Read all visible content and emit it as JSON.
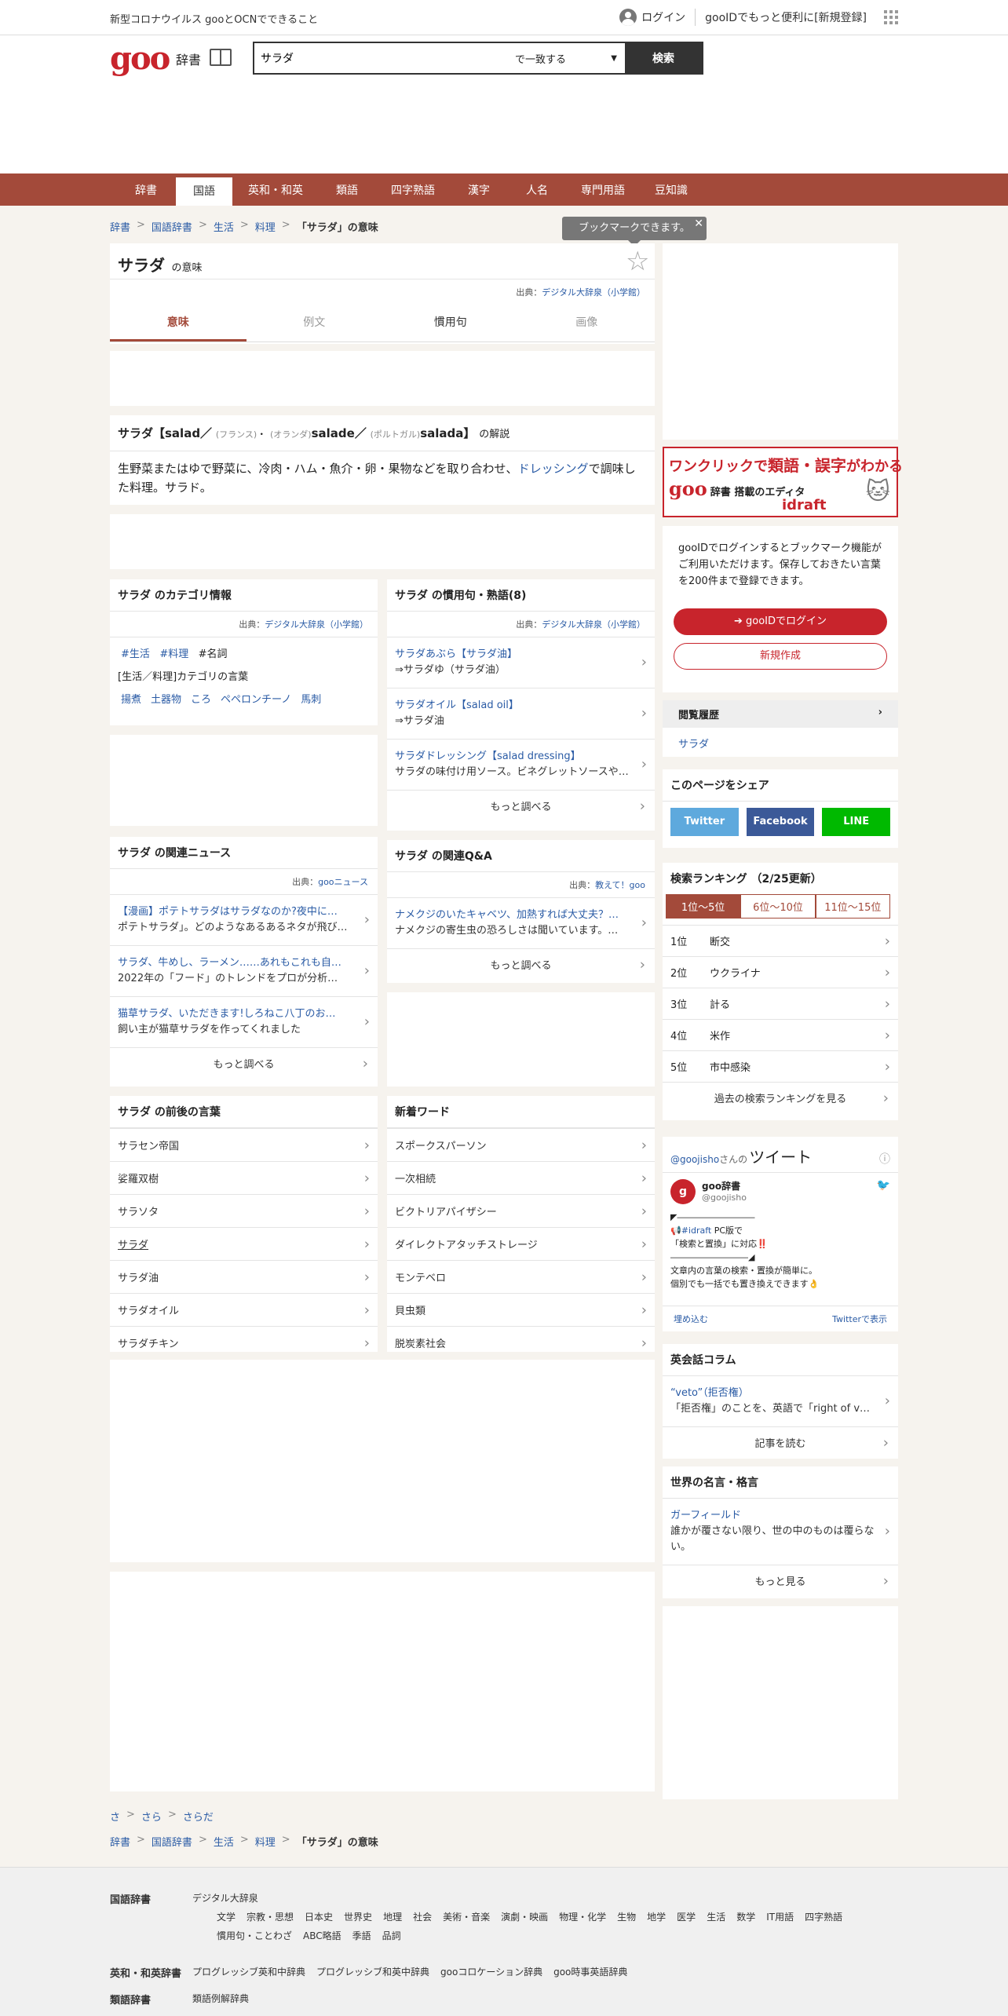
{
  "topbar": {
    "notice": "新型コロナウイルス gooとOCNでできること",
    "login": "ログイン",
    "register": "gooIDでもっと便利に[新規登録]"
  },
  "header": {
    "logo": "goo",
    "logo_sub": "辞書",
    "search_value": "サラダ",
    "search_mode": "で一致する",
    "search_button": "検索"
  },
  "nav": [
    "辞書",
    "国語",
    "英和・和英",
    "類語",
    "四字熟語",
    "漢字",
    "人名",
    "専門用語",
    "豆知識"
  ],
  "breadcrumb": [
    "辞書",
    "国語辞書",
    "生活",
    "料理",
    "「サラダ」の意味"
  ],
  "tooltip": "ブックマークできます。",
  "entry": {
    "word": "サラダ",
    "suffix": "の意味",
    "source_label": "出典：",
    "source": "デジタル大辞泉（小学館）",
    "tabs": [
      "意味",
      "例文",
      "慣用句",
      "画像"
    ],
    "heading_word": "サラダ【salad／",
    "h_lang1": "(フランス)",
    "h_mid1": "・",
    "h_lang2": "(オランダ)",
    "h_w2": "salade／",
    "h_lang3": "(ポルトガル)",
    "h_w3": "salada】",
    "h_suffix": "の解説",
    "def_pre": "生野菜またはゆで野菜に、冷肉・ハム・魚介・卵・果物などを取り合わせ、",
    "def_link": "ドレッシング",
    "def_post": "で調味した料理。サラド。"
  },
  "category": {
    "title": "サラダ のカテゴリ情報",
    "source": "デジタル大辞泉（小学館）",
    "tags": [
      "#生活",
      "#料理"
    ],
    "tag_plain": "#名詞",
    "cat_text": "[生活／料理]カテゴリの言葉",
    "words": [
      "揚煮",
      "土器物",
      "ころ",
      "ペペロンチーノ",
      "馬刺"
    ]
  },
  "idioms": {
    "title": "サラダ の慣用句・熟語(8)",
    "source": "デジタル大辞泉（小学館）",
    "items": [
      {
        "t": "サラダあぶら【サラダ油】",
        "d": "⇒サラダゆ（サラダ油）"
      },
      {
        "t": "サラダオイル【salad oil】",
        "d": "⇒サラダ油"
      },
      {
        "t": "サラダドレッシング【salad dressing】",
        "d": "サラダの味付け用ソース。ビネグレットソースやマヨネーズなど。"
      }
    ],
    "more": "もっと調べる"
  },
  "news": {
    "title": "サラダ の関連ニュース",
    "source": "gooニュース",
    "items": [
      {
        "t": "【漫画】ポテトサラダはサラダなのか?夜中に…",
        "d": "ポテトサラダ」。どのようなあるあるネタが飛び出すか…"
      },
      {
        "t": "サラダ、牛めし、ラーメン……あれもこれも自…",
        "d": "2022年の「フード」のトレンドをプロが分析…"
      },
      {
        "t": "猫草サラダ、いただきます!しろねこ八丁のお…",
        "d": "飼い主が猫草サラダを作ってくれました"
      }
    ],
    "more": "もっと調べる"
  },
  "qa": {
    "title": "サラダ の関連Q&A",
    "source": "教えて！goo",
    "items": [
      {
        "t": "ナメクジのいたキャベツ、加熱すれば大丈夫？…",
        "d": "ナメクジの寄生虫の恐ろしさは聞いています。…"
      }
    ],
    "more": "もっと調べる"
  },
  "nearby": {
    "title": "サラダ の前後の言葉",
    "items": [
      "サラセン帝国",
      "娑羅双樹",
      "サラソタ",
      "サラダ",
      "サラダ油",
      "サラダオイル",
      "サラダチキン"
    ]
  },
  "newwords": {
    "title": "新着ワード",
    "items": [
      "スポークスパーソン",
      "一次相続",
      "ビクトリアパイザシー",
      "ダイレクトアタッチストレージ",
      "モンテベロ",
      "貝虫類",
      "脱炭素社会"
    ]
  },
  "side": {
    "ad_text1": "ワンクリックで",
    "ad_text2": "類語・誤字",
    "ad_text3": "がわかる",
    "ad_logo": "goo",
    "ad_sub": "辞書 搭載のエディタ",
    "ad_brand": "idraft",
    "login_text": "gooIDでログインするとブックマーク機能がご利用いただけます。保存しておきたい言葉を200件まで登録できます。",
    "login_btn": "gooIDでログイン",
    "signup_btn": "新規作成",
    "history_title": "閲覧履歴",
    "history_item": "サラダ",
    "share_title": "このページをシェア",
    "share": [
      "Twitter",
      "Facebook",
      "LINE"
    ],
    "rank_title": "検索ランキング （2/25更新）",
    "rank_tabs": [
      "1位～5位",
      "6位～10位",
      "11位～15位"
    ],
    "ranks": [
      {
        "n": "1位",
        "w": "断交"
      },
      {
        "n": "2位",
        "w": "ウクライナ"
      },
      {
        "n": "3位",
        "w": "計る"
      },
      {
        "n": "4位",
        "w": "米作"
      },
      {
        "n": "5位",
        "w": "市中感染"
      }
    ],
    "rank_more": "過去の検索ランキングを見る",
    "tw_handle": "@goojisho",
    "tw_san": "さんの",
    "tw_title": "ツイート",
    "tw_name": "goo辞書",
    "tw_id": "@goojisho",
    "tw_line1": "◤―――――――――",
    "tw_line2a": "#idraft",
    "tw_line2b": " PC版で",
    "tw_line3": "「検索と置換」に対応‼️",
    "tw_line4": "―――――――――◢",
    "tw_line5": "文章内の言葉の検索・置換が簡単に。",
    "tw_line6": "個別でも一括でも置き換えできます👌",
    "tw_embed": "埋め込む",
    "tw_view": "Twitterで表示",
    "col_title": "英会話コラム",
    "col_t": "“veto”（拒否権）",
    "col_d": "「拒否権」のことを、英語で「right of veto」と…",
    "col_more": "記事を読む",
    "quote_title": "世界の名言・格言",
    "quote_t": "ガーフィールド",
    "quote_d": "誰かが覆さない限り、世の中のものは覆らない。",
    "quote_more": "もっと見る"
  },
  "bottom": {
    "kana": [
      "さ",
      "さら",
      "さらだ"
    ],
    "footer": {
      "kokugo_h": "国語辞書",
      "kokugo_main": "デジタル大辞泉",
      "kokugo_links1": [
        "文学",
        "宗教・思想",
        "日本史",
        "世界史",
        "地理",
        "社会",
        "美術・音楽",
        "演劇・映画",
        "物理・化学",
        "生物",
        "地学",
        "医学",
        "生活",
        "数学",
        "IT用語",
        "四字熟語"
      ],
      "kokugo_links2": [
        "慣用句・ことわざ",
        "ABC略語",
        "季語",
        "品詞"
      ],
      "eiwa_h": "英和・和英辞書",
      "eiwa_links": [
        "プログレッシブ英和中辞典",
        "プログレッシブ和英中辞典",
        "gooコロケーション辞典",
        "goo時事英語辞典"
      ],
      "ruigo_h": "類語辞書",
      "ruigo_links": [
        "類語例解辞典"
      ]
    }
  }
}
